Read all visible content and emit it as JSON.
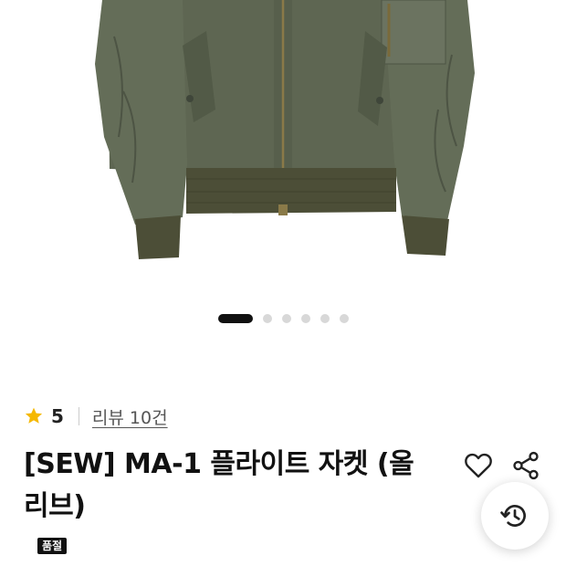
{
  "product": {
    "title": "[SEW] MA-1 플라이트 자켓 (올리브)",
    "rating_value": "5",
    "review_link": "리뷰 10건",
    "status_badge": "품절"
  },
  "carousel": {
    "total": 6,
    "active_index": 0
  },
  "icons": {
    "rating": "star-icon",
    "wishlist": "heart-icon",
    "share": "share-icon",
    "history": "history-icon"
  },
  "colors": {
    "star": "#F5B800",
    "jacket": "#5E6652",
    "rib": "#4C4E37",
    "badge": "#111111",
    "active_dot": "#111111"
  }
}
